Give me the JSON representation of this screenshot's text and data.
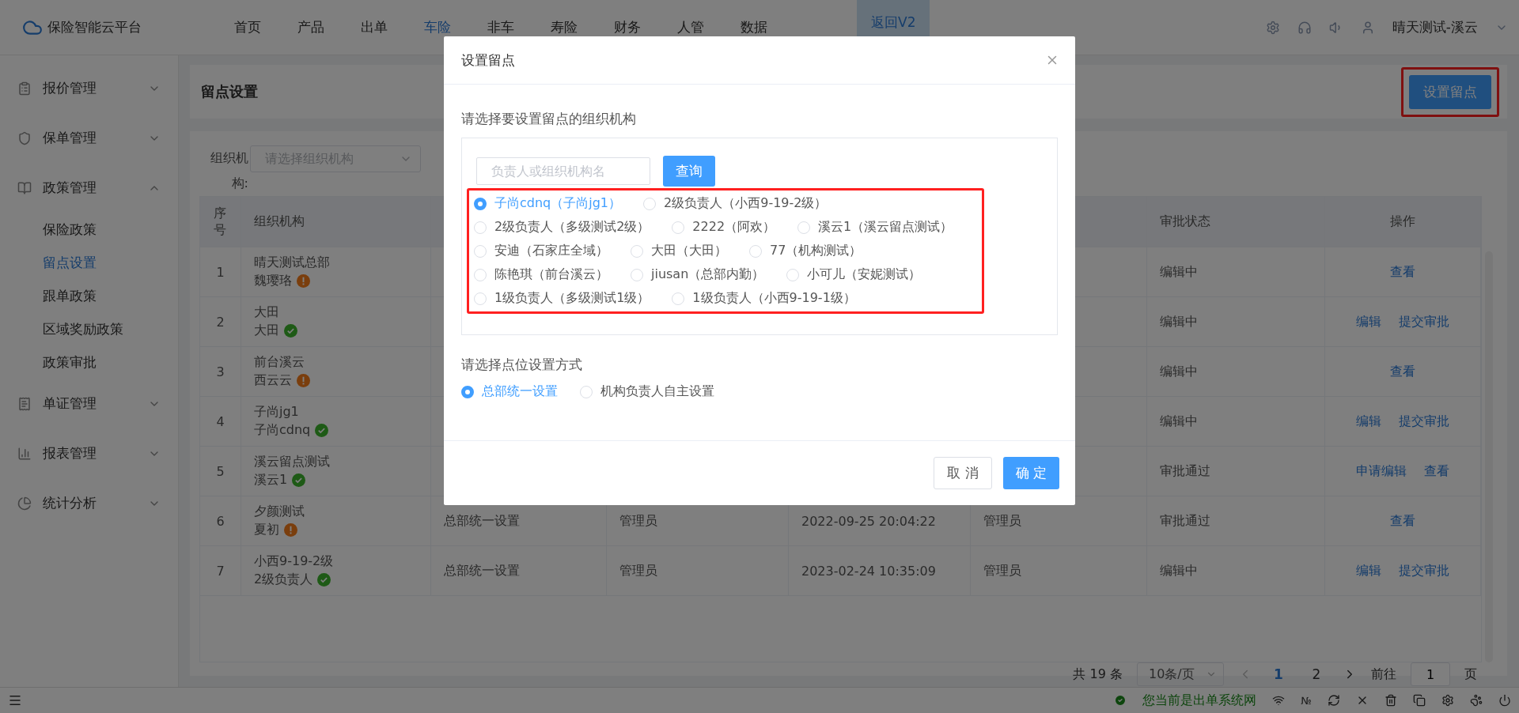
{
  "app": {
    "name": "保险智能云平台"
  },
  "nav": [
    {
      "label": "首页",
      "selected": false
    },
    {
      "label": "产品",
      "selected": false
    },
    {
      "label": "出单",
      "selected": false
    },
    {
      "label": "车险",
      "selected": true
    },
    {
      "label": "非车",
      "selected": false
    },
    {
      "label": "寿险",
      "selected": false
    },
    {
      "label": "财务",
      "selected": false
    },
    {
      "label": "人管",
      "selected": false
    },
    {
      "label": "数据",
      "selected": false
    }
  ],
  "return_button": "返回V2",
  "user": "晴天测试-溪云",
  "sidebar": [
    {
      "label": "报价管理",
      "expanded": false
    },
    {
      "label": "保单管理",
      "expanded": false
    },
    {
      "label": "政策管理",
      "expanded": true,
      "children": [
        {
          "label": "保险政策",
          "selected": false
        },
        {
          "label": "留点设置",
          "selected": true
        },
        {
          "label": "跟单政策",
          "selected": false
        },
        {
          "label": "区域奖励政策",
          "selected": false
        },
        {
          "label": "政策审批",
          "selected": false
        }
      ]
    },
    {
      "label": "单证管理",
      "expanded": false
    },
    {
      "label": "报表管理",
      "expanded": false
    },
    {
      "label": "统计分析",
      "expanded": false
    }
  ],
  "page_title": "留点设置",
  "header_button": "设置留点",
  "filter": {
    "label": "组织机构:",
    "placeholder": "请选择组织机构"
  },
  "table": {
    "columns": [
      "序号",
      "组织机构",
      "审批状态",
      "操作"
    ],
    "rows": [
      {
        "no": "1",
        "org": "晴天测试总部",
        "person": "魏璎珞",
        "kind": "warning",
        "approval": "编辑中",
        "actions": [
          "查看"
        ]
      },
      {
        "no": "2",
        "org": "大田",
        "person": "大田",
        "kind": "ok",
        "approval": "编辑中",
        "actions": [
          "编辑",
          "提交审批"
        ]
      },
      {
        "no": "3",
        "org": "前台溪云",
        "person": "西云云",
        "kind": "warning",
        "approval": "编辑中",
        "actions": [
          "查看"
        ]
      },
      {
        "no": "4",
        "org": "子尚jg1",
        "person": "子尚cdnq",
        "kind": "ok",
        "approval": "编辑中",
        "actions": [
          "编辑",
          "提交审批"
        ]
      },
      {
        "no": "5",
        "org": "溪云留点测试",
        "person": "溪云1",
        "kind": "ok",
        "approval": "审批通过",
        "actions": [
          "申请编辑",
          "查看"
        ]
      },
      {
        "no": "6",
        "org": "夕颜测试",
        "person": "夏初",
        "kind": "warning",
        "mode": "总部统一设置",
        "creator": "管理员",
        "time": "2022-09-25 20:04:22",
        "approver": "管理员",
        "approval": "审批通过",
        "actions": [
          "查看"
        ]
      },
      {
        "no": "7",
        "org": "小西9-19-2级",
        "person": "2级负责人",
        "kind": "ok",
        "mode": "总部统一设置",
        "creator": "管理员",
        "time": "2023-02-24 10:35:09",
        "approver": "管理员",
        "approval": "编辑中",
        "actions": [
          "编辑",
          "提交审批"
        ]
      }
    ]
  },
  "pagination": {
    "total": "共 19 条",
    "page_size": "10条/页",
    "pages": [
      {
        "label": "1",
        "selected": true
      },
      {
        "label": "2",
        "selected": false
      }
    ],
    "goto_label": "前往",
    "goto_value": "1",
    "goto_suffix": "页"
  },
  "status_bar": {
    "message": "您当前是出单系统网",
    "number_sign": "№"
  },
  "dialog": {
    "title": "设置留点",
    "org_prompt": "请选择要设置留点的组织机构",
    "search_placeholder": "负责人或组织机构名",
    "search_button": "查询",
    "orgs": [
      {
        "label": "子尚cdnq（子尚jg1）",
        "selected": true
      },
      {
        "label": "2级负责人（小西9-19-2级）",
        "selected": false
      },
      {
        "label": "2级负责人（多级测试2级）",
        "selected": false
      },
      {
        "label": "2222（阿欢）",
        "selected": false
      },
      {
        "label": "溪云1（溪云留点测试）",
        "selected": false
      },
      {
        "label": "安迪（石家庄全域）",
        "selected": false
      },
      {
        "label": "大田（大田）",
        "selected": false
      },
      {
        "label": "77（机构测试）",
        "selected": false
      },
      {
        "label": "陈艳琪（前台溪云）",
        "selected": false
      },
      {
        "label": "jiusan（总部内勤）",
        "selected": false
      },
      {
        "label": "小可儿（安妮测试）",
        "selected": false
      },
      {
        "label": "1级负责人（多级测试1级）",
        "selected": false
      },
      {
        "label": "1级负责人（小西9-19-1级）",
        "selected": false
      }
    ],
    "mode_prompt": "请选择点位设置方式",
    "modes": [
      {
        "label": "总部统一设置",
        "selected": true
      },
      {
        "label": "机构负责人自主设置",
        "selected": false
      }
    ],
    "cancel": "取 消",
    "confirm": "确 定"
  }
}
